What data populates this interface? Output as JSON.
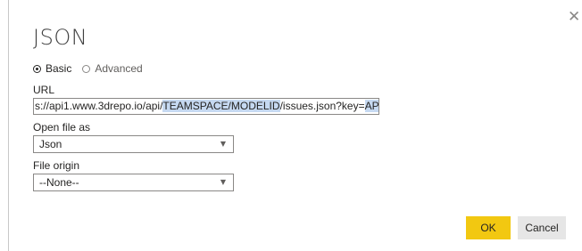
{
  "dialog": {
    "title": "JSON",
    "close_icon": "close-icon",
    "mode": {
      "options": [
        {
          "label": "Basic",
          "selected": true
        },
        {
          "label": "Advanced",
          "selected": false
        }
      ]
    },
    "url": {
      "label": "URL",
      "value_segments": [
        {
          "text": "s://api1.www.3drepo.io/api/",
          "highlight": false
        },
        {
          "text": "TEAMSPACE/MODELID",
          "highlight": true
        },
        {
          "text": "/issues.json?key=",
          "highlight": false
        },
        {
          "text": "APIKEY",
          "highlight": true
        }
      ]
    },
    "open_file_as": {
      "label": "Open file as",
      "value": "Json"
    },
    "file_origin": {
      "label": "File origin",
      "value": "--None--"
    },
    "buttons": {
      "ok": "OK",
      "cancel": "Cancel"
    },
    "colors": {
      "accent": "#f2c811",
      "highlight": "#c6d9f1"
    }
  }
}
